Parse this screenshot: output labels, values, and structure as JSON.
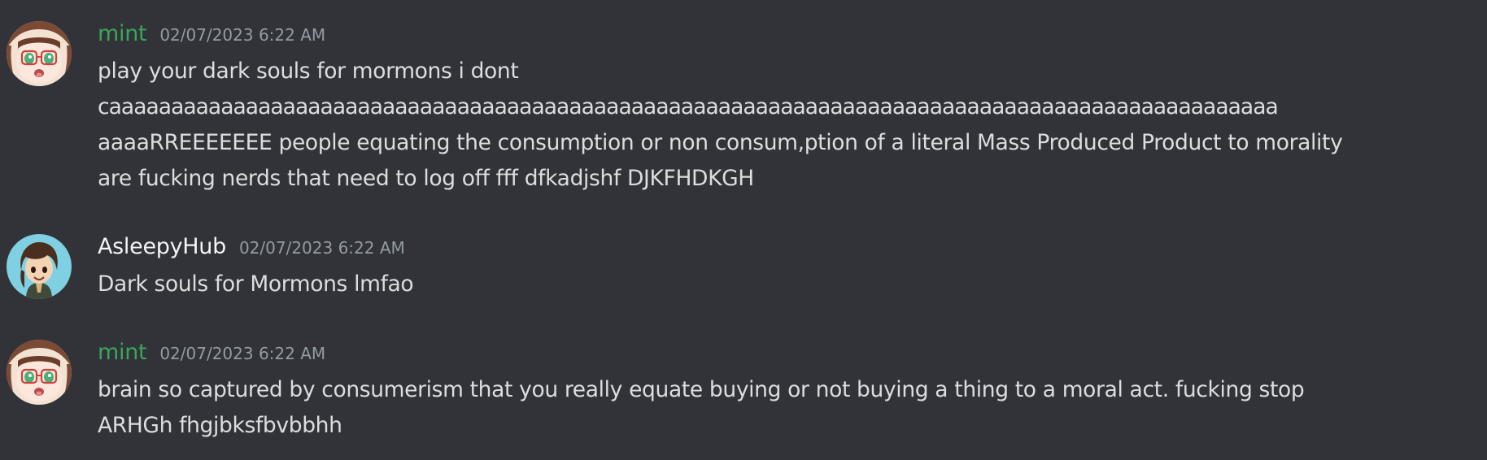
{
  "theme": {
    "background": "#313338",
    "text": "#dbdee1",
    "timestamp": "#949ba4"
  },
  "messages": [
    {
      "author": "mint",
      "author_color": "#3ba55c",
      "avatar_icon": "anime-girl-glasses-avatar",
      "timestamp": "02/07/2023 6:22 AM",
      "lines": [
        "play your dark souls for mormons i dont",
        "caaaaaaaaaaaaaaaaaaaaaaaaaaaaaaaaaaaaaaaaaaaaaaaaaaaaaaaaaaaaaaaaaaaaaaaaaaaaaaaaaaaaaaaaaaaaaa",
        "aaaaRREEEEEEE people equating the consumption or non consum,ption of a literal Mass Produced Product to morality",
        "are fucking nerds that need to log off fff dfkadjshf DJKFHDKGH"
      ]
    },
    {
      "author": "AsleepyHub",
      "author_color": "#f2f3f5",
      "avatar_icon": "brown-hair-character-avatar",
      "timestamp": "02/07/2023 6:22 AM",
      "lines": [
        "Dark souls for Mormons lmfao"
      ]
    },
    {
      "author": "mint",
      "author_color": "#3ba55c",
      "avatar_icon": "anime-girl-glasses-avatar",
      "timestamp": "02/07/2023 6:22 AM",
      "lines": [
        "brain so captured by consumerism that you really equate buying or not buying a thing to a moral act. fucking stop",
        "ARHGh fhgjbksfbvbbhh"
      ]
    }
  ]
}
